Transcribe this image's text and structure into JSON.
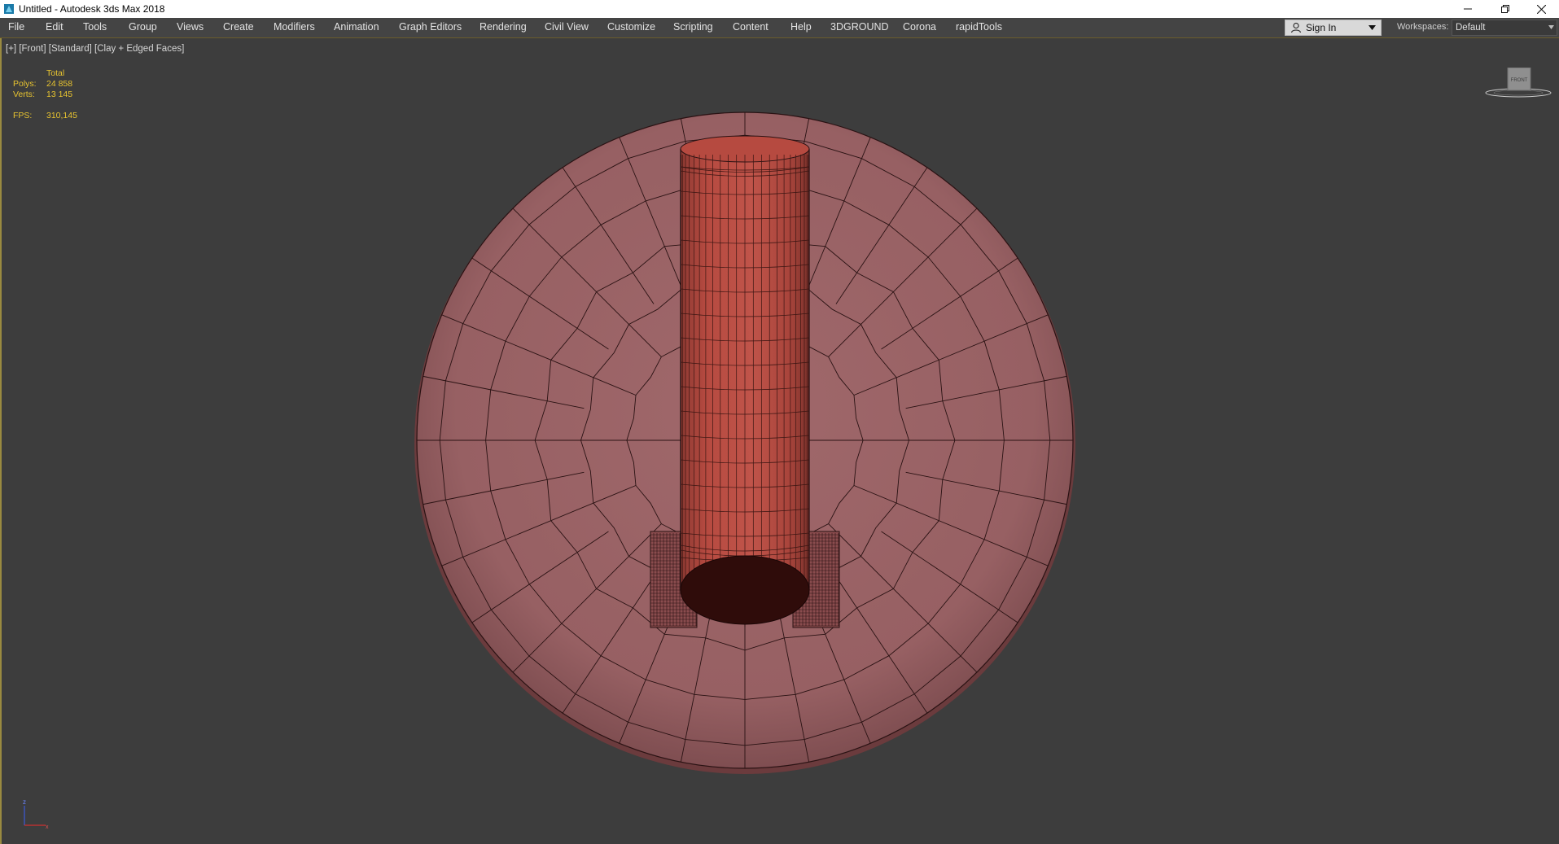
{
  "window": {
    "title": "Untitled - Autodesk 3ds Max 2018",
    "app_icon": "3ds-max-icon",
    "controls": [
      "minimize-icon",
      "restore-icon",
      "close-icon"
    ]
  },
  "menu": {
    "items": [
      "File",
      "Edit",
      "Tools",
      "Group",
      "Views",
      "Create",
      "Modifiers",
      "Animation",
      "Graph Editors",
      "Rendering",
      "Civil View",
      "Customize",
      "Scripting",
      "Content",
      "Help",
      "3DGROUND",
      "Corona",
      "rapidTools"
    ],
    "sign_in": "Sign In",
    "workspaces_label": "Workspaces:",
    "workspace_value": "Default"
  },
  "viewport": {
    "plus": "[+]",
    "view": "[Front]",
    "shading_standard": "[Standard]",
    "shading_mode": "[Clay + Edged Faces]",
    "stats": {
      "header": "Total",
      "polys_label": "Polys:",
      "polys_value": "24 858",
      "verts_label": "Verts:",
      "verts_value": "13 145",
      "fps_label": "FPS:",
      "fps_value": "310,145"
    },
    "viewcube_label": "FRONT",
    "axis_labels": [
      "z",
      "x"
    ]
  },
  "colors": {
    "menubar_bg": "#444444",
    "viewport_bg": "#3d3d3d",
    "stats_text": "#e8c430",
    "clay_base": "#9b6265",
    "clay_cylinder": "#b54a40",
    "edge_lines": "#2a1213"
  }
}
